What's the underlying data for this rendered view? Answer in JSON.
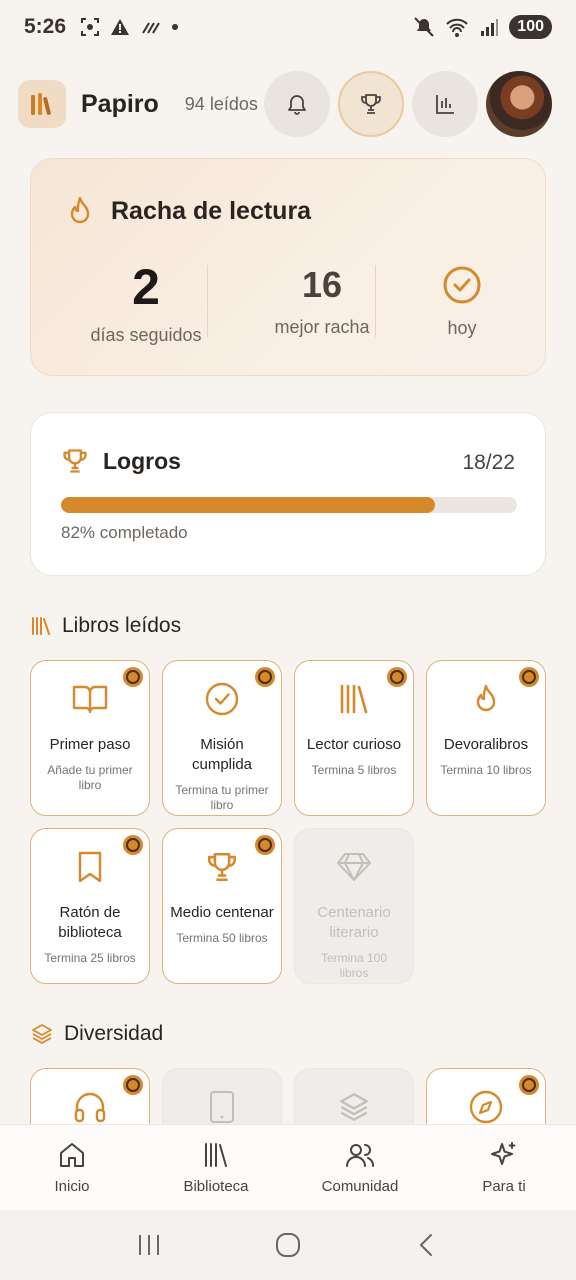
{
  "status_bar": {
    "time": "5:26",
    "battery": "100"
  },
  "header": {
    "app_name": "Papiro",
    "read_count": "94 leídos"
  },
  "streak": {
    "title": "Racha de lectura",
    "days_value": "2",
    "days_label": "días seguidos",
    "best_value": "16",
    "best_label": "mejor racha",
    "today_label": "hoy"
  },
  "achievements": {
    "title": "Logros",
    "count": "18/22",
    "progress_fraction": 0.82,
    "percent_text": "82% completado"
  },
  "sections": {
    "books_read": "Libros leídos",
    "diversity": "Diversidad"
  },
  "badges_books": [
    {
      "name": "Primer paso",
      "desc": "Añade tu primer libro",
      "icon": "book-open-icon",
      "unlocked": true
    },
    {
      "name": "Misión cumplida",
      "desc": "Termina tu primer libro",
      "icon": "check-circle-icon",
      "unlocked": true
    },
    {
      "name": "Lector curioso",
      "desc": "Termina 5 libros",
      "icon": "books-icon",
      "unlocked": true
    },
    {
      "name": "Devoralibros",
      "desc": "Termina 10 libros",
      "icon": "flame-icon",
      "unlocked": true
    },
    {
      "name": "Ratón de biblioteca",
      "desc": "Termina 25 libros",
      "icon": "bookmark-icon",
      "unlocked": true
    },
    {
      "name": "Medio centenar",
      "desc": "Termina 50 libros",
      "icon": "trophy-icon",
      "unlocked": true
    },
    {
      "name": "Centenario literario",
      "desc": "Termina 100 libros",
      "icon": "diamond-icon",
      "unlocked": false
    }
  ],
  "badges_diversity": [
    {
      "icon": "headphones-icon",
      "unlocked": true
    },
    {
      "icon": "tablet-icon",
      "unlocked": false
    },
    {
      "icon": "layers-icon",
      "unlocked": false
    },
    {
      "icon": "compass-icon",
      "unlocked": true
    }
  ],
  "bottom_nav": [
    {
      "label": "Inicio",
      "icon": "home-icon"
    },
    {
      "label": "Biblioteca",
      "icon": "library-icon"
    },
    {
      "label": "Comunidad",
      "icon": "users-icon"
    },
    {
      "label": "Para ti",
      "icon": "sparkles-icon"
    }
  ],
  "colors": {
    "accent": "#d6892a",
    "background": "#f7f4ef",
    "locked": "#efede9"
  }
}
